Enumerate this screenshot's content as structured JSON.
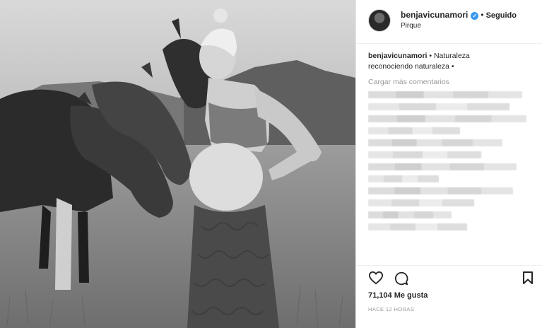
{
  "post": {
    "username": "benjavicunamori",
    "verified_mark": "✓",
    "separator": "•",
    "follow_status": "Seguido",
    "location": "Pirque"
  },
  "caption": {
    "username": "benjavicunamori",
    "text_line1": "• Naturaleza",
    "text_line2": "reconociendo naturaleza •"
  },
  "comments": {
    "load_more": "Cargar más comentarios"
  },
  "actions": {
    "like_icon": "heart-icon",
    "comment_icon": "comment-icon",
    "save_icon": "bookmark-icon"
  },
  "likes": "71,104 Me gusta",
  "timestamp": "HACE 12 HORAS",
  "colors": {
    "verified": "#3897f0",
    "muted_text": "#999999",
    "text": "#262626"
  }
}
